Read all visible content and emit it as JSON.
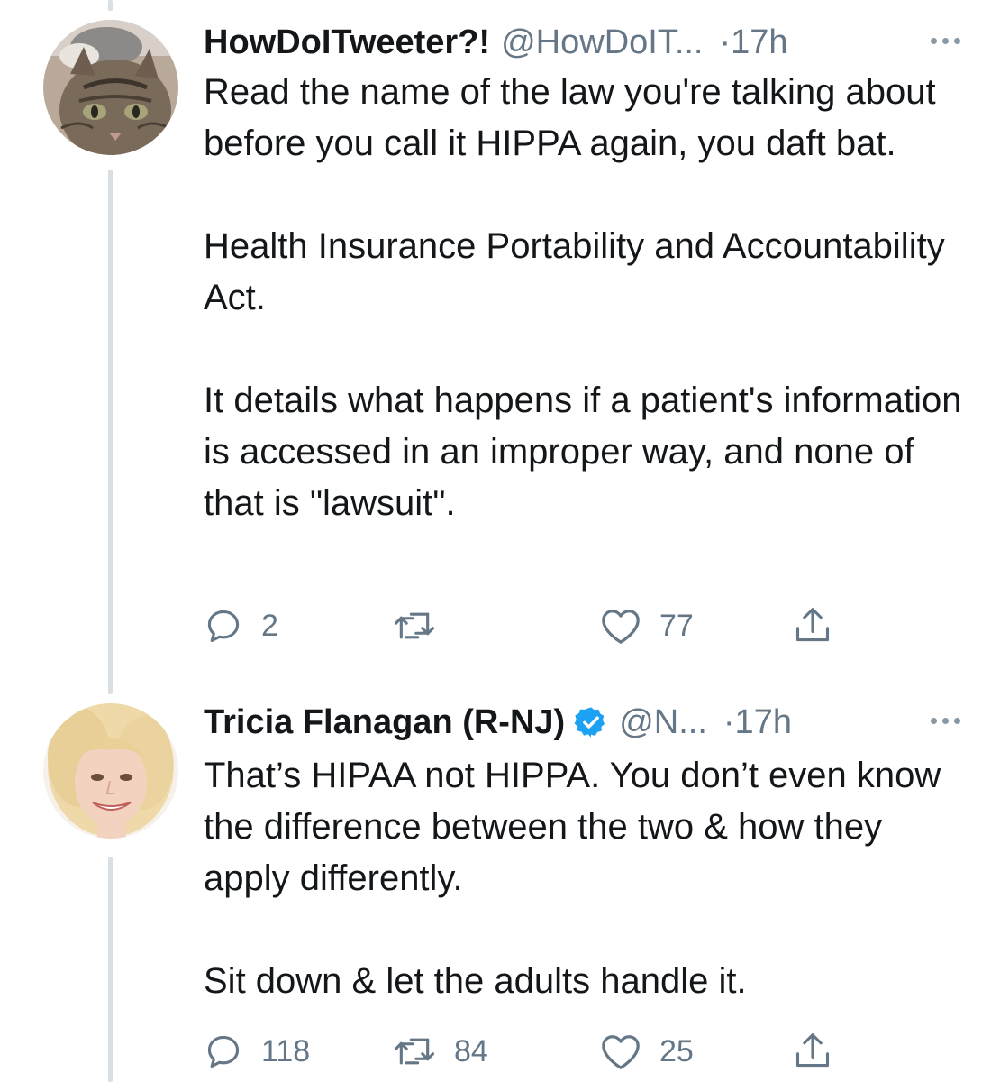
{
  "tweets": [
    {
      "display_name": "HowDoITweeter?!",
      "handle": "@HowDoIT...",
      "time": "·17h",
      "verified": false,
      "avatar": "cat-avatar",
      "paragraphs": [
        "Read the name of the law you're talking about before you call it HIPPA again, you daft bat.",
        "Health Insurance Portability and Accountability Act.",
        "It details what happens if a patient's information is accessed in an improper way, and none of that is \"lawsuit\"."
      ],
      "reply_count": "2",
      "retweet_count": "",
      "like_count": "77"
    },
    {
      "display_name": "Tricia Flanagan (R-NJ)",
      "handle": "@N...",
      "time": "·17h",
      "verified": true,
      "avatar": "woman-avatar",
      "paragraphs": [
        "That’s HIPAA not HIPPA.  You don’t even know the difference between the two & how they apply differently.",
        "Sit down & let the adults handle it."
      ],
      "reply_count": "118",
      "retweet_count": "84",
      "like_count": "25"
    }
  ],
  "icons": {
    "reply": "reply-icon",
    "retweet": "retweet-icon",
    "like": "heart-icon",
    "share": "share-icon",
    "more": "more-icon",
    "verified": "verified-badge-icon"
  },
  "colors": {
    "text": "#14171a",
    "secondary": "#657786",
    "verified": "#1da1f2",
    "thread_line": "#d9dfe3"
  }
}
